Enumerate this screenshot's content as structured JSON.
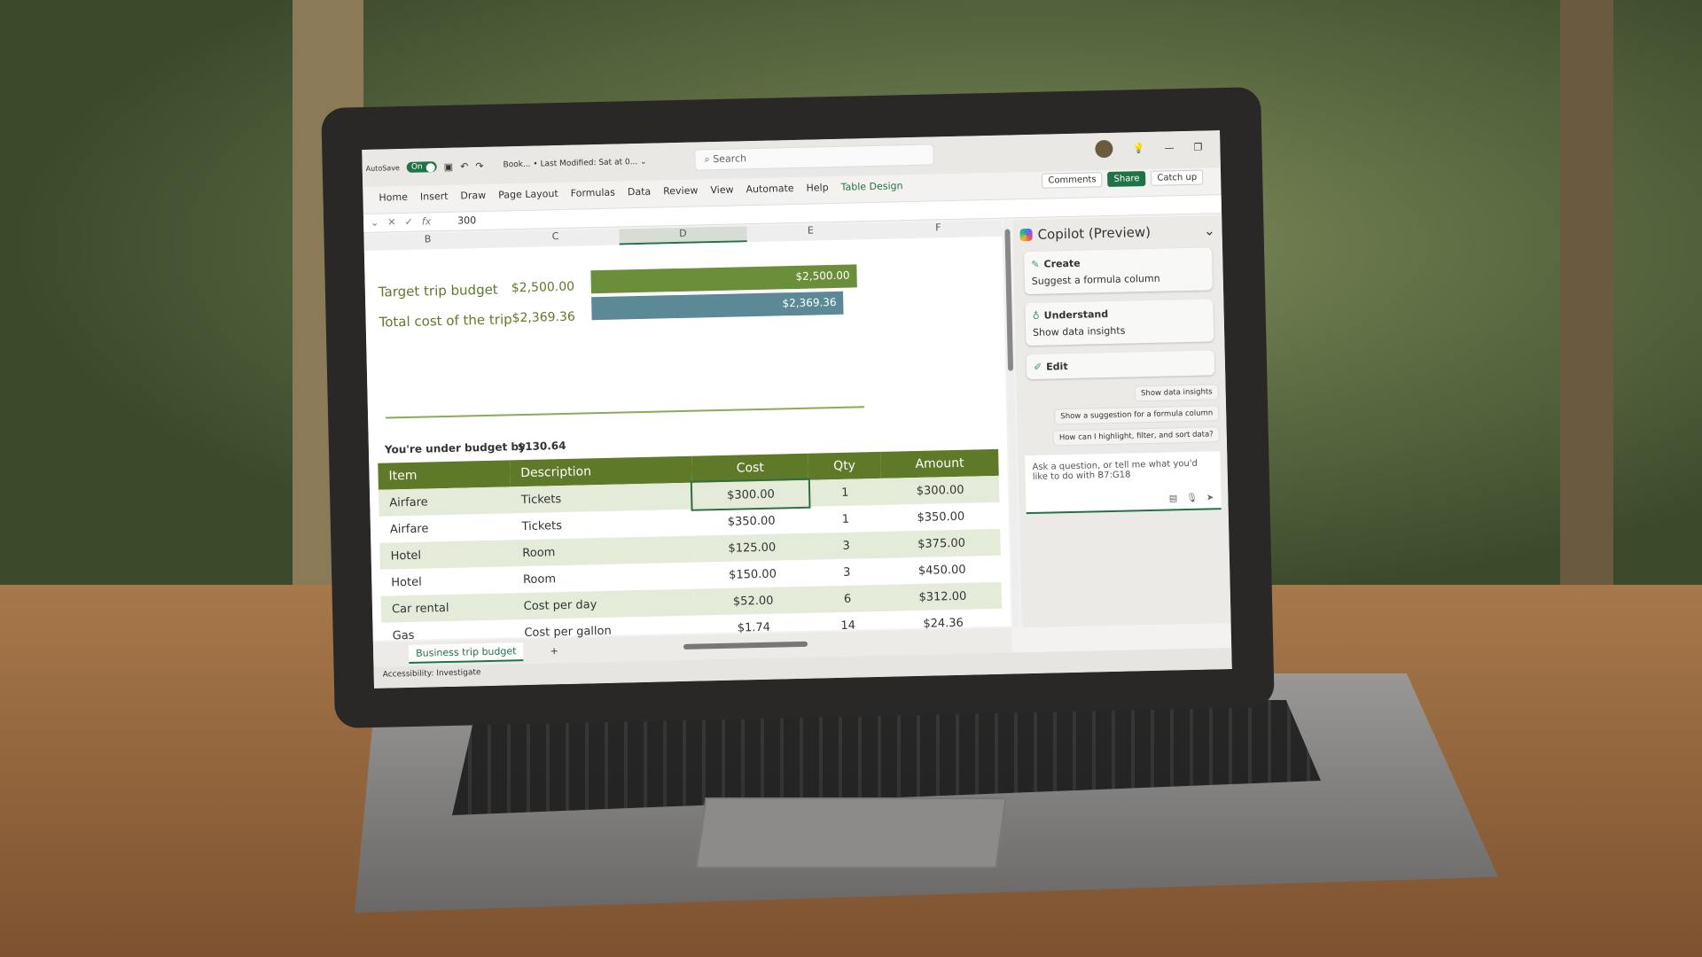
{
  "titlebar": {
    "autosave": "AutoSave",
    "toggle": "On",
    "doc": "Book... • Last Modified: Sat at 0... ⌄",
    "search": "Search"
  },
  "tabs": [
    "Home",
    "Insert",
    "Draw",
    "Page Layout",
    "Formulas",
    "Data",
    "Review",
    "View",
    "Automate",
    "Help",
    "Table Design"
  ],
  "actions": {
    "comments": "Comments",
    "share": "Share",
    "catchup": "Catch up"
  },
  "formula": {
    "value": "300"
  },
  "columns": [
    "B",
    "C",
    "D",
    "E",
    "F"
  ],
  "budget": {
    "target_label": "Target trip budget",
    "target_value": "$2,500.00",
    "total_label": "Total cost of the trip",
    "total_value": "$2,369.36",
    "under_label": "You're under budget by",
    "under_value": "$130.64",
    "colors": {
      "target": "#6b8e3a",
      "total": "#5b8a96"
    }
  },
  "table": {
    "headers": [
      "Item",
      "Description",
      "Cost",
      "Qty",
      "Amount"
    ],
    "rows": [
      [
        "Airfare",
        "Tickets",
        "$300.00",
        "1",
        "$300.00"
      ],
      [
        "Airfare",
        "Tickets",
        "$350.00",
        "1",
        "$350.00"
      ],
      [
        "Hotel",
        "Room",
        "$125.00",
        "3",
        "$375.00"
      ],
      [
        "Hotel",
        "Room",
        "$150.00",
        "3",
        "$450.00"
      ],
      [
        "Car rental",
        "Cost per day",
        "$52.00",
        "6",
        "$312.00"
      ],
      [
        "Gas",
        "Cost per gallon",
        "$1.74",
        "14",
        "$24.36"
      ]
    ]
  },
  "sheet": {
    "tab": "Business trip budget",
    "add": "+"
  },
  "status": {
    "accessibility": "Accessibility: Investigate"
  },
  "copilot": {
    "title": "Copilot (Preview)",
    "cards": [
      {
        "title": "Create",
        "desc": "Suggest a formula column"
      },
      {
        "title": "Understand",
        "desc": "Show data insights"
      },
      {
        "title": "Edit"
      }
    ],
    "chips": [
      "Show data insights",
      "Show a suggestion for a formula column",
      "How can I highlight, filter, and sort data?"
    ],
    "placeholder": "Ask a question, or tell me what you'd like to do with B7:G18"
  }
}
